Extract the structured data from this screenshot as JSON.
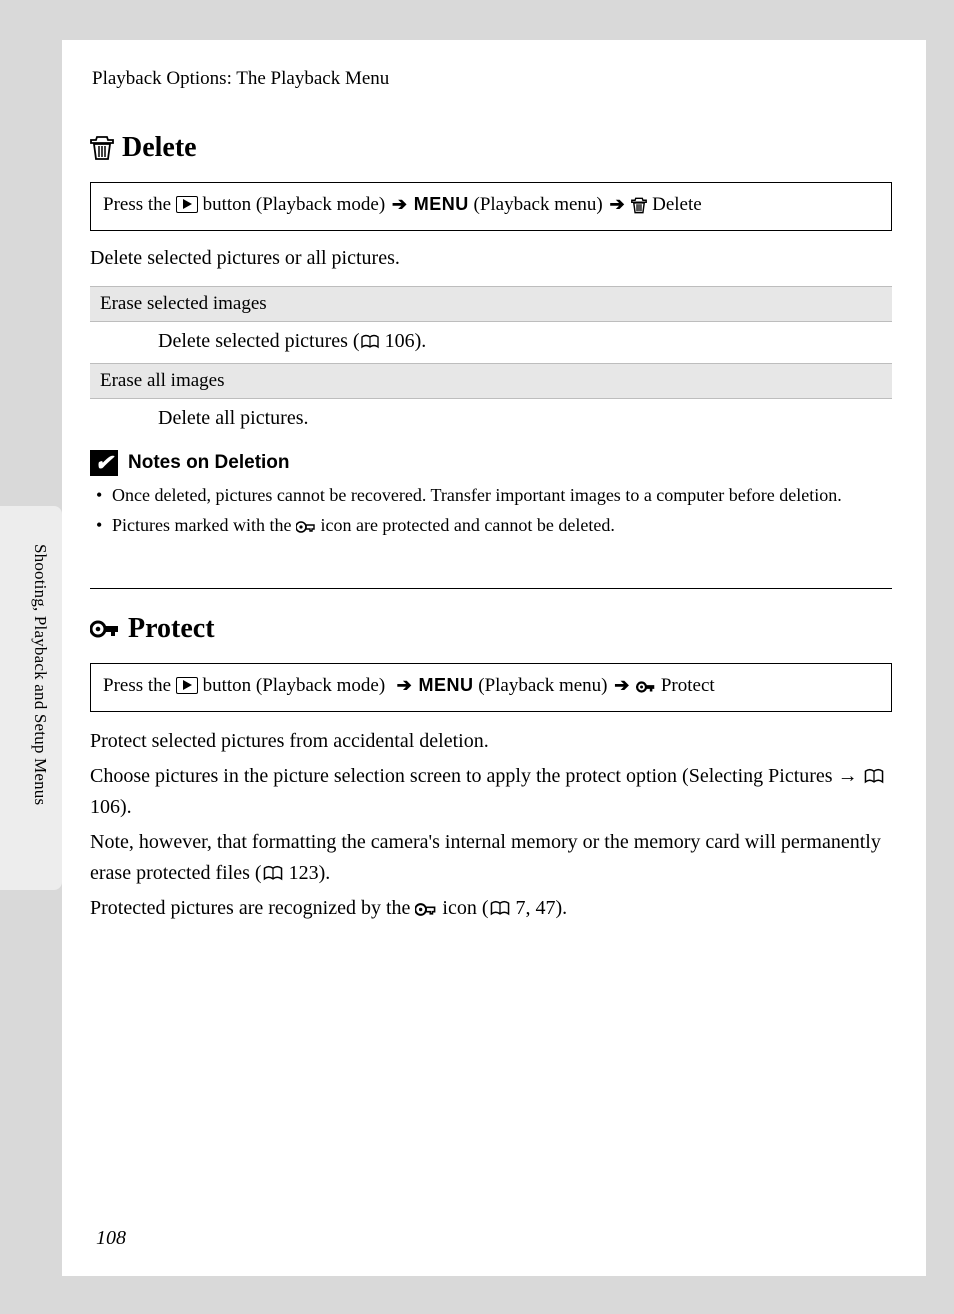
{
  "sideLabel": "Shooting, Playback and Setup Menus",
  "breadcrumb": "Playback Options: The Playback Menu",
  "delete": {
    "title": "Delete",
    "nav": {
      "prefix": "Press the",
      "playMode": "button (Playback mode)",
      "menu": "MENU",
      "playMenu": "(Playback menu)",
      "tail": "Delete"
    },
    "desc": "Delete selected pictures or all pictures.",
    "options": [
      {
        "head": "Erase selected images",
        "body_pre": "Delete selected pictures (",
        "body_ref": "106",
        "body_post": ")."
      },
      {
        "head": "Erase all images",
        "body_pre": "Delete all pictures.",
        "body_ref": "",
        "body_post": ""
      }
    ],
    "notesTitle": "Notes on Deletion",
    "notes": {
      "n1": "Once deleted, pictures cannot be recovered. Transfer important images to a computer before deletion.",
      "n2_pre": "Pictures marked with the ",
      "n2_post": " icon are protected and cannot be deleted."
    }
  },
  "protect": {
    "title": "Protect",
    "nav": {
      "prefix": "Press the",
      "playMode": "button (Playback mode)",
      "menu": "MENU",
      "playMenu": "(Playback menu)",
      "tail": "Protect"
    },
    "p1": "Protect selected pictures from accidental deletion.",
    "p2_pre": "Choose pictures in the picture selection screen to apply the protect option (Selecting Pictures → ",
    "p2_ref": "106",
    "p2_post": ").",
    "p3_pre": "Note, however, that formatting the camera's internal memory or the memory card will permanently erase protected files (",
    "p3_ref": "123",
    "p3_post": ").",
    "p4_pre": "Protected pictures are recognized by the ",
    "p4_mid": " icon (",
    "p4_ref": "7, 47",
    "p4_post": ")."
  },
  "pageNumber": "108"
}
